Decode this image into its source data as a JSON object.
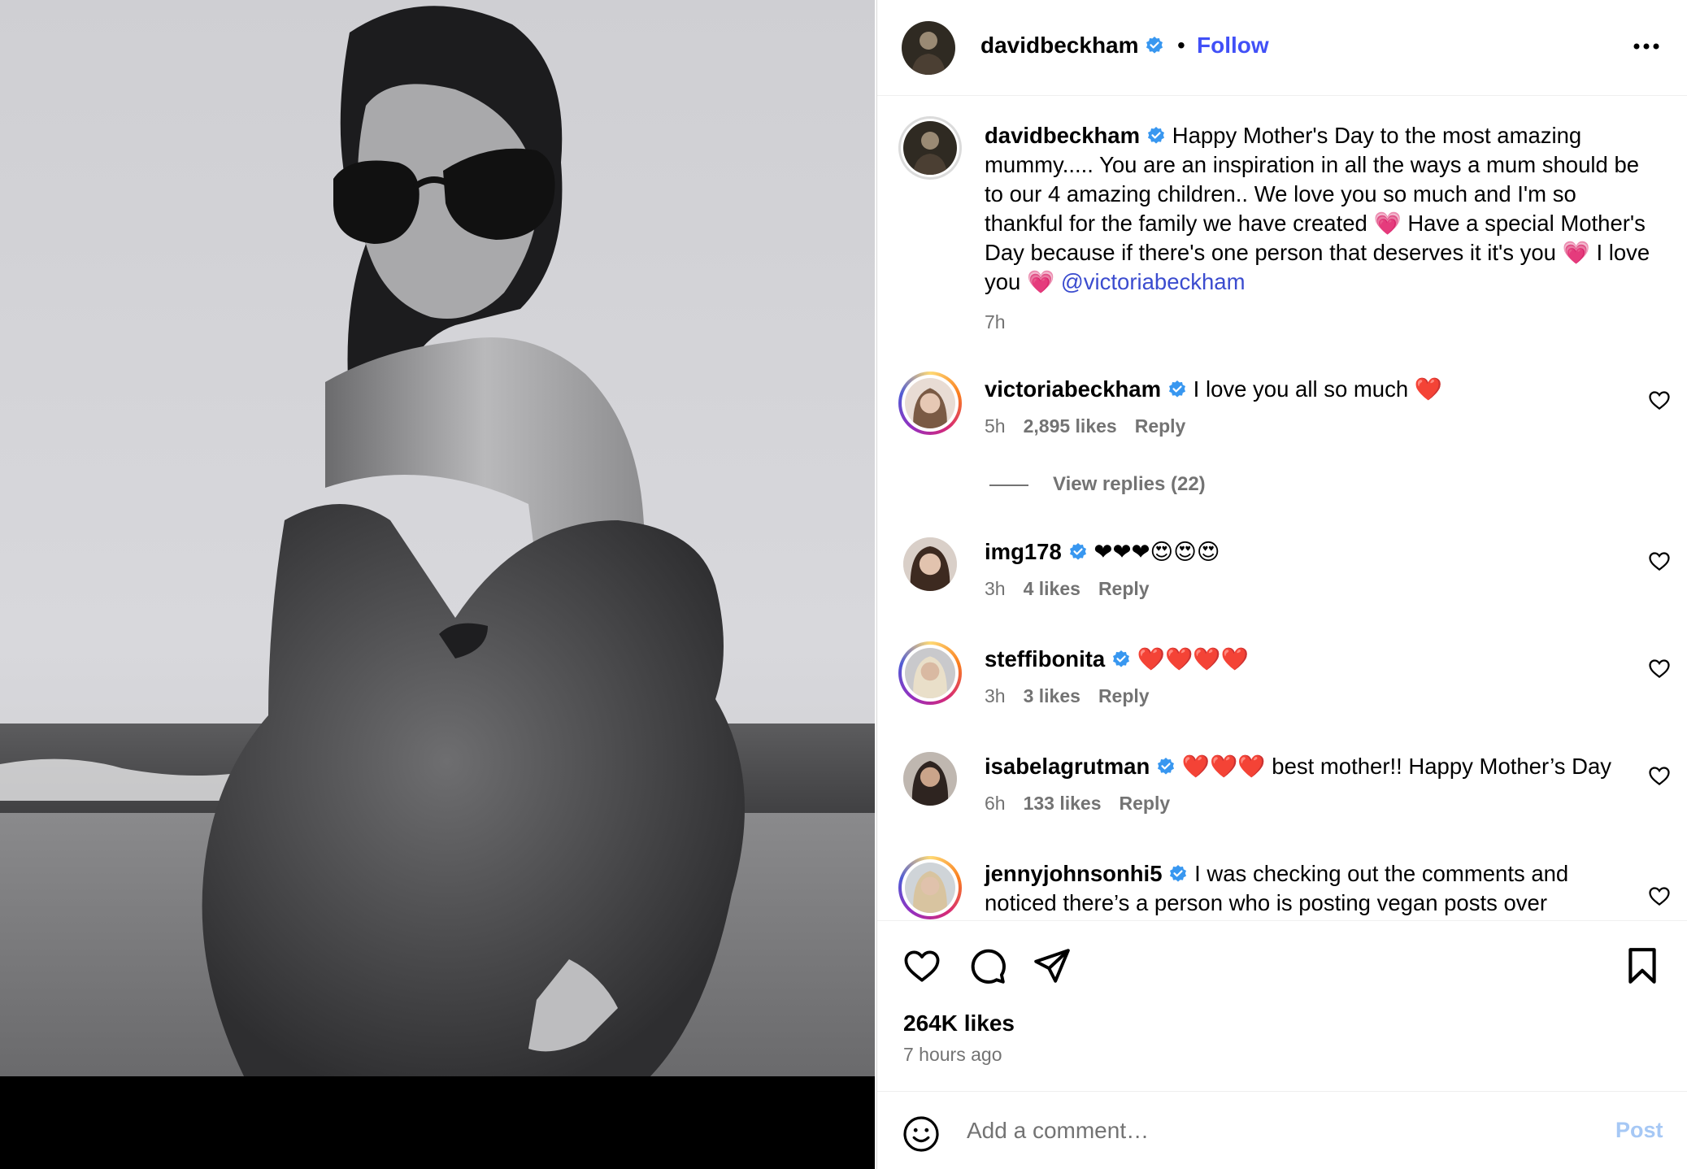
{
  "post": {
    "author": "davidbeckham",
    "follow_label": "Follow",
    "separator": "•",
    "more_icon": "more-horizontal-icon",
    "caption_text": " Happy Mother's Day to the most amazing mummy..... You are an inspiration in all the ways a mum should be to our 4 amazing children.. We love you so much and I'm so thankful for the family we have created 💗 Have a special Mother's Day because if there's one person that deserves it it's you 💗 I love you 💗 ",
    "mention": "@victoriabeckham",
    "caption_time": "7h",
    "likes": "264K likes",
    "posted_ago": "7 hours ago"
  },
  "comments": [
    {
      "user": "victoriabeckham",
      "text": " I love you all so much ❤️",
      "time": "5h",
      "likes": "2,895 likes",
      "reply": "Reply"
    },
    {
      "user": "img178",
      "text": " ❤❤❤😍😍😍",
      "time": "3h",
      "likes": "4 likes",
      "reply": "Reply"
    },
    {
      "user": "steffibonita",
      "text": " ❤️❤️❤️❤️",
      "time": "3h",
      "likes": "3 likes",
      "reply": "Reply"
    },
    {
      "user": "isabelagrutman",
      "text": " ❤️❤️❤️ best mother!! Happy Mother’s Day",
      "time": "6h",
      "likes": "133 likes",
      "reply": "Reply"
    },
    {
      "user": "jennyjohnsonhi5",
      "text": " I was checking out the comments and noticed there’s a person who is posting vegan posts over"
    }
  ],
  "view_replies": "View replies (22)",
  "composer": {
    "placeholder": "Add a comment…",
    "post_label": "Post"
  },
  "colors": {
    "follow": "#4150f7",
    "mention": "#3b4ccf",
    "verified": "#3897f0",
    "post_disabled": "#a6c8f5"
  },
  "icons": [
    "verified-badge-icon",
    "heart-icon",
    "comment-icon",
    "share-icon",
    "bookmark-icon",
    "emoji-icon"
  ]
}
